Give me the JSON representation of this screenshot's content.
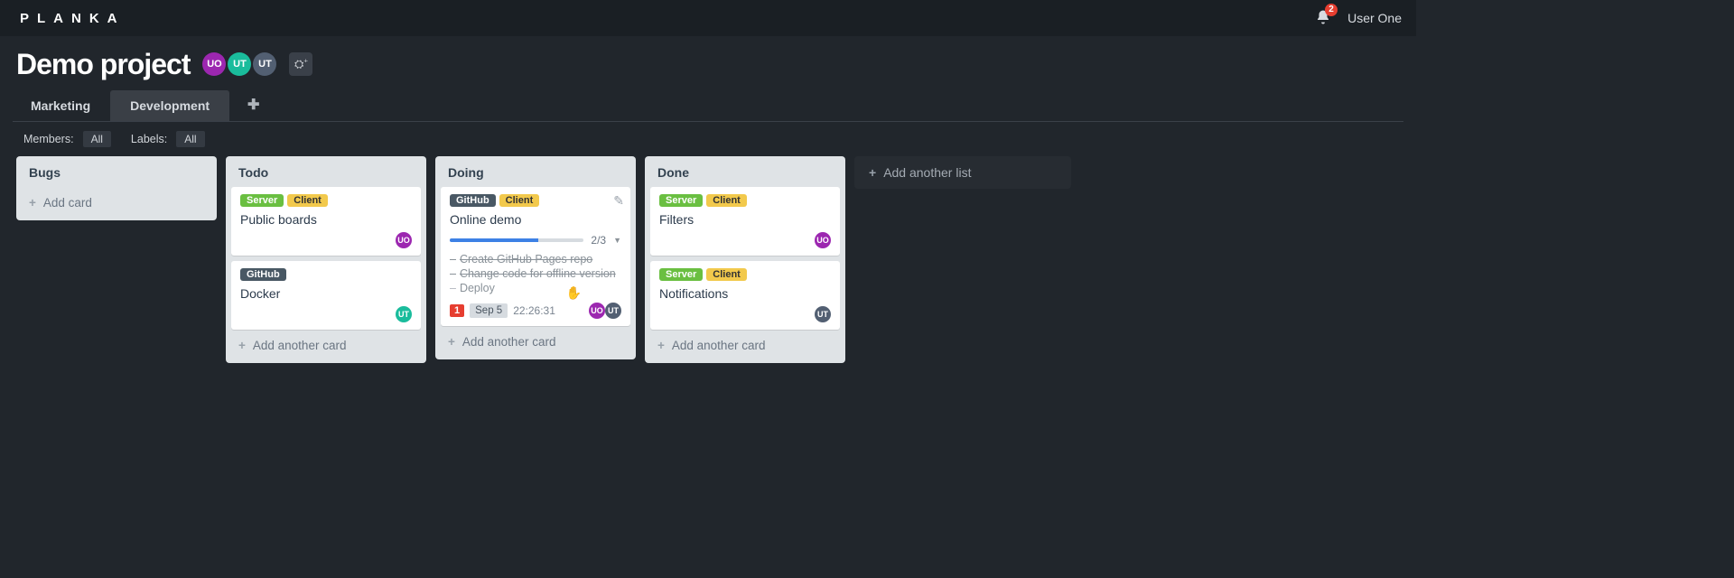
{
  "app_name": "PLANKA",
  "notifications": 2,
  "user": "User One",
  "project": {
    "title": "Demo project",
    "members": [
      {
        "initials": "UO",
        "color": "p0"
      },
      {
        "initials": "UT",
        "color": "p1"
      },
      {
        "initials": "UT",
        "color": "p2"
      }
    ],
    "boards": [
      {
        "name": "Marketing",
        "active": false
      },
      {
        "name": "Development",
        "active": true
      }
    ]
  },
  "filters": {
    "members_label": "Members:",
    "members_value": "All",
    "labels_label": "Labels:",
    "labels_value": "All"
  },
  "lists": [
    {
      "title": "Bugs",
      "cards": [],
      "add_label": "Add card",
      "empty": true
    },
    {
      "title": "Todo",
      "add_label": "Add another card",
      "cards": [
        {
          "labels": [
            {
              "text": "Server",
              "cls": "lg"
            },
            {
              "text": "Client",
              "cls": "ly"
            }
          ],
          "title": "Public boards",
          "avatars": [
            {
              "initials": "UO",
              "color": "p0"
            }
          ]
        },
        {
          "labels": [
            {
              "text": "GitHub",
              "cls": "ld"
            }
          ],
          "title": "Docker",
          "avatars": [
            {
              "initials": "UT",
              "color": "p1"
            }
          ]
        }
      ]
    },
    {
      "title": "Doing",
      "add_label": "Add another card",
      "cards": [
        {
          "labels": [
            {
              "text": "GitHub",
              "cls": "ld"
            },
            {
              "text": "Client",
              "cls": "ly"
            }
          ],
          "title": "Online demo",
          "edit": true,
          "progress": {
            "done": 2,
            "total": 3,
            "text": "2/3",
            "pct": 66
          },
          "checklist": [
            {
              "text": "Create GitHub Pages repo",
              "done": true
            },
            {
              "text": "Change code for offline version",
              "done": true
            },
            {
              "text": "Deploy",
              "done": false
            }
          ],
          "meta": {
            "count": "1",
            "date": "Sep 5",
            "timer": "22:26:31"
          },
          "avatars": [
            {
              "initials": "UO",
              "color": "p0"
            },
            {
              "initials": "UT",
              "color": "p2"
            }
          ],
          "grab": true
        }
      ]
    },
    {
      "title": "Done",
      "add_label": "Add another card",
      "cards": [
        {
          "labels": [
            {
              "text": "Server",
              "cls": "lg"
            },
            {
              "text": "Client",
              "cls": "ly"
            }
          ],
          "title": "Filters",
          "avatars": [
            {
              "initials": "UO",
              "color": "p0"
            }
          ]
        },
        {
          "labels": [
            {
              "text": "Server",
              "cls": "lg"
            },
            {
              "text": "Client",
              "cls": "ly"
            }
          ],
          "title": "Notifications",
          "avatars": [
            {
              "initials": "UT",
              "color": "p2"
            }
          ]
        }
      ]
    }
  ],
  "add_list_label": "Add another list"
}
